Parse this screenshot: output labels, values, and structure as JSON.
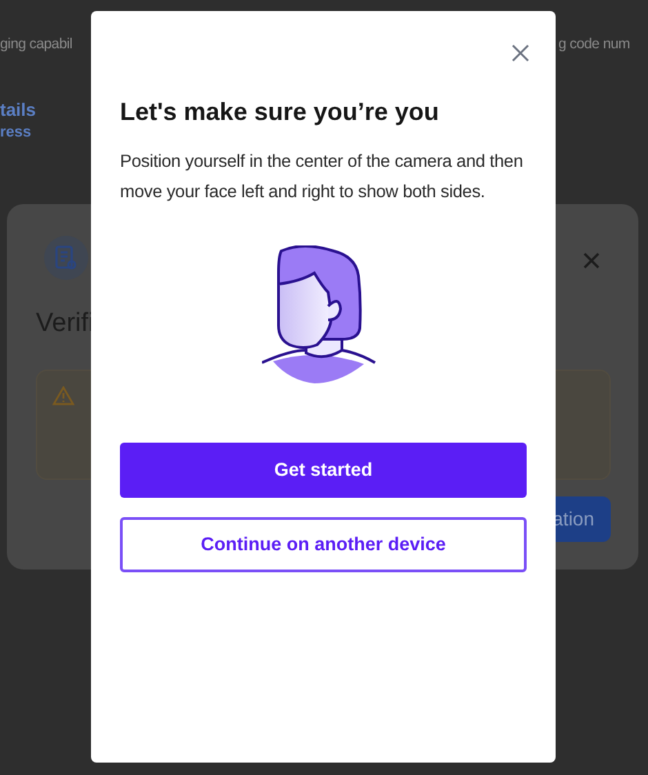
{
  "background_page": {
    "text_left": "ging capabil",
    "text_right": "g code num",
    "section_title": "tails",
    "section_subtitle": "ress"
  },
  "back_dialog": {
    "title": "Verifi",
    "button": "ation"
  },
  "dialog": {
    "title": "Let's make sure you’re you",
    "description": "Position yourself in the center of the camera and then move your face left and right to show both sides.",
    "primary_button": "Get started",
    "secondary_button": "Continue on another device"
  }
}
